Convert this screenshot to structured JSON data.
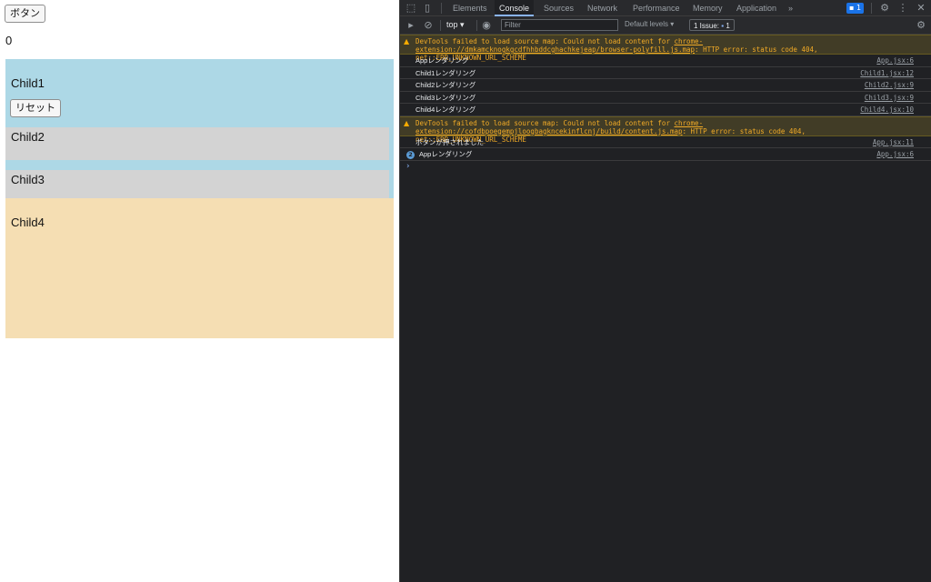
{
  "app": {
    "button_label": "ボタン",
    "count": "0",
    "child1": {
      "title": "Child1",
      "reset_label": "リセット"
    },
    "child2": {
      "title": "Child2"
    },
    "child3": {
      "title": "Child3"
    },
    "child4": {
      "title": "Child4"
    }
  },
  "devtools": {
    "tabs": [
      "Elements",
      "Console",
      "Sources",
      "Network",
      "Performance",
      "Memory",
      "Application"
    ],
    "more_tabs": "»",
    "active_tab": "Console",
    "message_badge": "1",
    "toolbar": {
      "context": "top ▾",
      "filter_placeholder": "Filter",
      "levels": "Default levels ▾",
      "issues_label": "1 Issue:",
      "issues_count": "1"
    },
    "log": {
      "warn1": {
        "prefix": "DevTools failed to load source map: Could not load content for ",
        "link": "chrome-extension://dmkamcknogkgcdfhhbddcghachkejeap/browser-polyfill.js.map",
        "suffix": ": HTTP error: status code 404, net::ERR_UNKNOWN_URL_SCHEME"
      },
      "rows1": [
        {
          "msg": "Appレンダリング",
          "src": "App.jsx:6"
        },
        {
          "msg": "Child1レンダリング",
          "src": "Child1.jsx:12"
        },
        {
          "msg": "Child2レンダリング",
          "src": "Child2.jsx:9"
        },
        {
          "msg": "Child3レンダリング",
          "src": "Child3.jsx:9"
        },
        {
          "msg": "Child4レンダリング",
          "src": "Child4.jsx:10"
        }
      ],
      "warn2": {
        "prefix": "DevTools failed to load source map: Could not load content for ",
        "link": "chrome-extension://cofdbpoegempjloogbagkncekinflcnj/build/content.js.map",
        "suffix": ": HTTP error: status code 404, net::ERR_UNKNOWN_URL_SCHEME"
      },
      "row_pressed": {
        "msg": "ボタンが押されました",
        "src": "App.jsx:11"
      },
      "row_repeat": {
        "count": "2",
        "msg": "Appレンダリング",
        "src": "App.jsx:6"
      },
      "prompt": "›"
    }
  },
  "colors": {
    "child1_bg": "#add8e6",
    "child_gray_bg": "#d3d3d3",
    "child4_bg": "#f5deb3",
    "devtools_bg": "#202124",
    "warning_text": "#f2ab26",
    "accent": "#8ab4f8"
  },
  "icons": [
    "inspect-icon",
    "device-toggle-icon",
    "sidebar-toggle-icon",
    "clear-console-icon",
    "eye-icon",
    "settings-icon",
    "kebab-menu-icon",
    "close-icon",
    "warning-icon",
    "message-icon"
  ]
}
